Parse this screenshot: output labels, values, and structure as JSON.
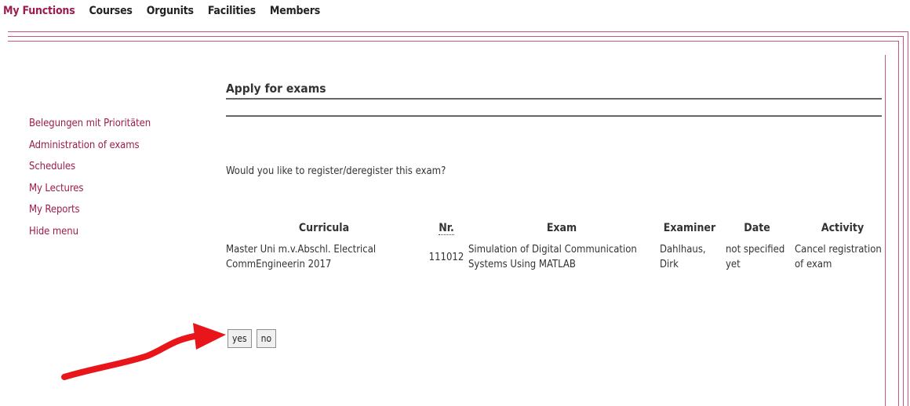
{
  "nav": {
    "items": [
      {
        "label": "My Functions",
        "active": true
      },
      {
        "label": "Courses"
      },
      {
        "label": "Orgunits"
      },
      {
        "label": "Facilities"
      },
      {
        "label": "Members"
      }
    ]
  },
  "sidebar": {
    "items": [
      {
        "label": "Belegungen mit Prioritäten"
      },
      {
        "label": "Administration of exams"
      },
      {
        "label": "Schedules"
      },
      {
        "label": "My Lectures"
      },
      {
        "label": "My Reports"
      },
      {
        "label": "Hide menu"
      }
    ]
  },
  "main": {
    "title": "Apply for exams",
    "question": "Would you like to register/deregister this exam?",
    "table": {
      "headers": [
        "Curricula",
        "Nr.",
        "Exam",
        "Examiner",
        "Date",
        "Activity"
      ],
      "row": {
        "curricula": "Master Uni m.v.Abschl. Electrical CommEngineerin 2017",
        "nr": "111012",
        "exam": "Simulation of Digital Communication Systems Using MATLAB",
        "examiner": "Dahlhaus, Dirk",
        "date": "not specified yet",
        "activity": "Cancel registration of exam"
      }
    },
    "buttons": {
      "yes": "yes",
      "no": "no"
    }
  },
  "colors": {
    "accent": "#9b1c4d",
    "arrow": "#e8161b",
    "frame": "#c9567a"
  }
}
